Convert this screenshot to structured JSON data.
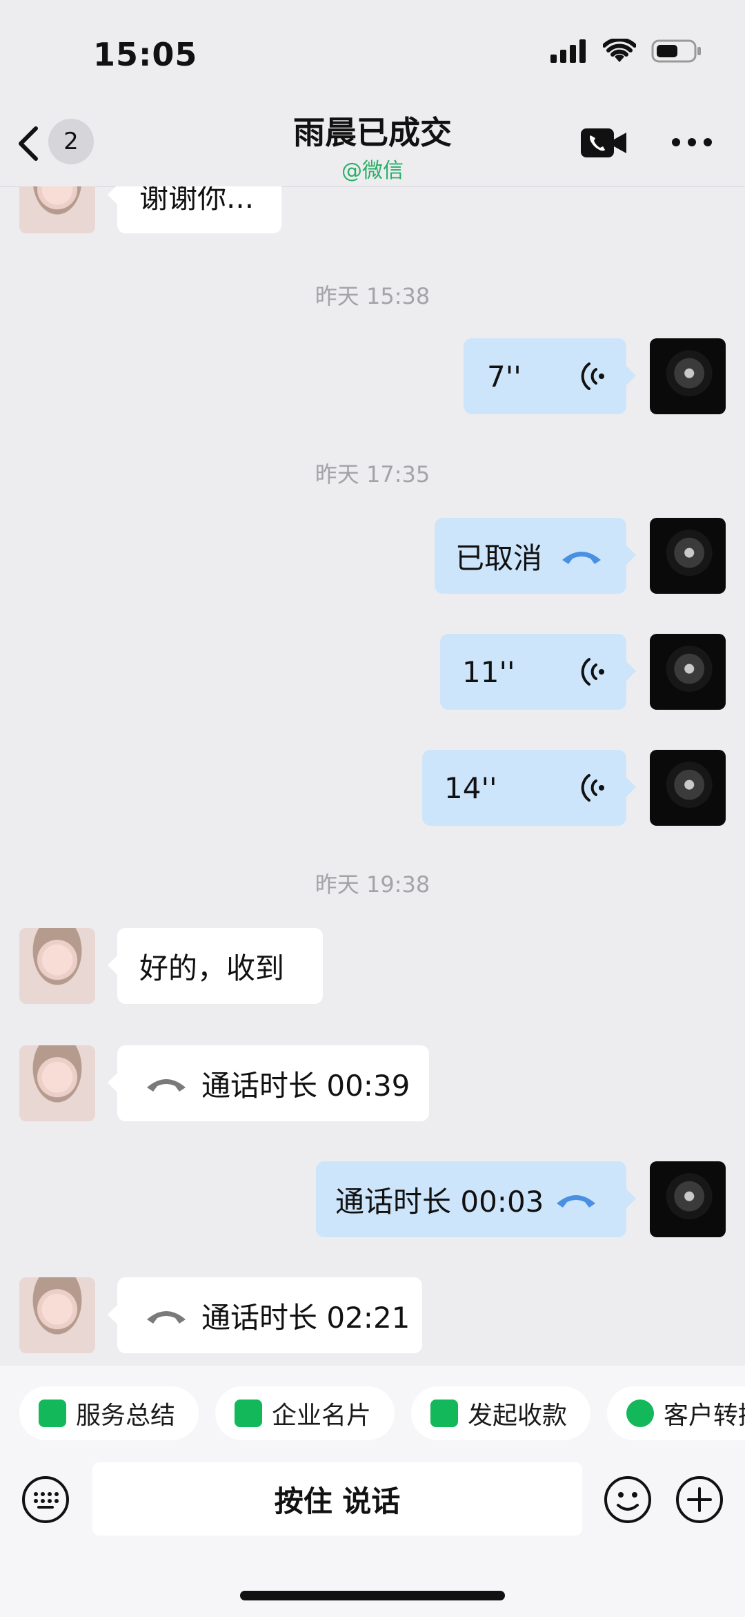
{
  "status_bar": {
    "time": "15:05"
  },
  "header": {
    "back_badge": "2",
    "title": "雨晨已成交",
    "subtitle": "@微信"
  },
  "messages": {
    "m0": "谢谢你...",
    "t1": "昨天 15:38",
    "m1": "7''",
    "t2": "昨天 17:35",
    "m2": "已取消",
    "m3": "11''",
    "m4": "14''",
    "t3": "昨天 19:38",
    "m5": "好的，收到",
    "m6": "通话时长 00:39",
    "m7": "通话时长 00:03",
    "m8": "通话时长 02:21"
  },
  "quick_actions": {
    "a1": "服务总结",
    "a2": "企业名片",
    "a3": "发起收款",
    "a4": "客户转接"
  },
  "input": {
    "voice_label": "按住 说话"
  },
  "colors": {
    "accent_green": "#12b85a",
    "bubble_blue": "#cde5fb",
    "phone_blue": "#4a90e2"
  }
}
